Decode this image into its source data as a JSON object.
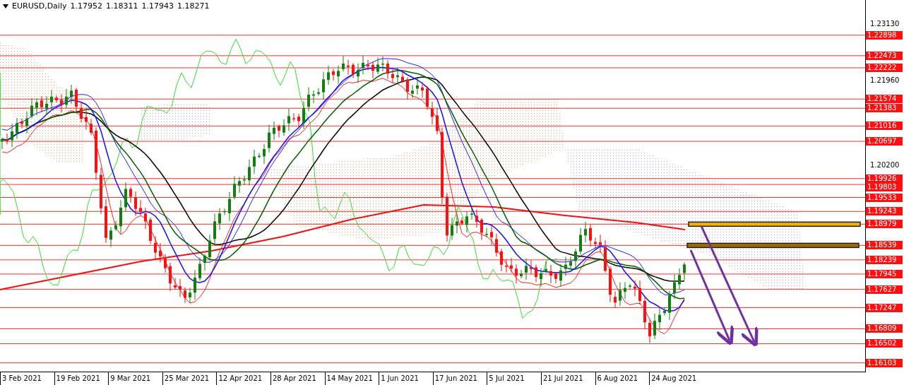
{
  "header": {
    "symbol": "EURUSD,Daily",
    "values": [
      "1.17952",
      "1.18311",
      "1.17943",
      "1.18271"
    ]
  },
  "price_ticks": [
    "1.23130",
    "1.21960",
    "1.20200"
  ],
  "levels": [
    {
      "label": "1.22898"
    },
    {
      "label": "1.22473"
    },
    {
      "label": "1.22222"
    },
    {
      "label": "1.21574"
    },
    {
      "label": "1.21383"
    },
    {
      "label": "1.21016"
    },
    {
      "label": "1.20697"
    },
    {
      "label": "1.19926"
    },
    {
      "label": "1.19803"
    },
    {
      "label": "1.19533"
    },
    {
      "label": "1.19243"
    },
    {
      "label": "1.18979"
    },
    {
      "label": "1.18539"
    },
    {
      "label": "1.18239"
    },
    {
      "label": "1.17945"
    },
    {
      "label": "1.17627"
    },
    {
      "label": "1.17247"
    },
    {
      "label": "1.16809"
    },
    {
      "label": "1.16502"
    },
    {
      "label": "1.16103"
    }
  ],
  "date_labels": [
    "3 Feb 2021",
    "19 Feb 2021",
    "9 Mar 2021",
    "25 Mar 2021",
    "12 Apr 2021",
    "28 Apr 2021",
    "14 May 2021",
    "1 Jun 2021",
    "17 Jun 2021",
    "5 Jul 2021",
    "21 Jul 2021",
    "6 Aug 2021",
    "24 Aug 2021"
  ]
}
